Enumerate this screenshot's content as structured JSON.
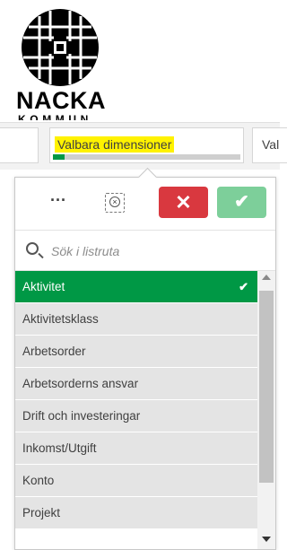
{
  "brand": {
    "name": "NACKA",
    "sub": "KOMMUN"
  },
  "tabs": [
    {
      "label": ""
    },
    {
      "label": "Valbara dimensioner",
      "highlight": "#fff200",
      "progress_fraction": 0.06
    },
    {
      "label": "Val"
    }
  ],
  "toolbar": {
    "more_label": "···",
    "cancel_icon": "close-icon",
    "confirm_icon": "check-icon"
  },
  "search": {
    "placeholder": "Sök i listruta"
  },
  "list": {
    "items": [
      {
        "label": "Aktivitet",
        "selected": true
      },
      {
        "label": "Aktivitetsklass"
      },
      {
        "label": "Arbetsorder"
      },
      {
        "label": "Arbetsorderns ansvar"
      },
      {
        "label": "Drift och investeringar"
      },
      {
        "label": "Inkomst/Utgift"
      },
      {
        "label": "Konto"
      },
      {
        "label": "Projekt"
      }
    ]
  },
  "colors": {
    "selected": "#009845",
    "cancel": "#d9383f",
    "confirm": "#7dcf9a"
  }
}
